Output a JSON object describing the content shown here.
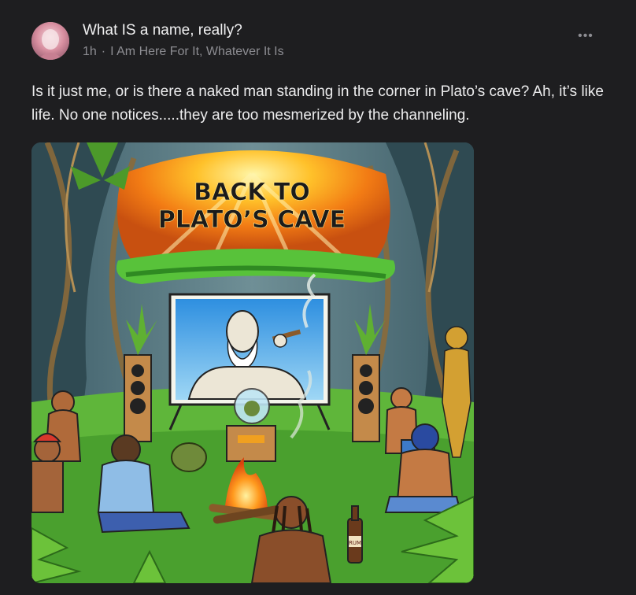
{
  "post": {
    "title": "What IS a name, really?",
    "time": "1h",
    "separator": "·",
    "category": "I Am Here For It, Whatever It Is",
    "more_icon": "more-horizontal-icon",
    "body": "Is it just me, or is there a naked man standing in the corner in Plato’s cave? Ah, it’s like life. No one notices.....they are too mesmerized by the channeling."
  },
  "image": {
    "banner_line1": "BACK TO",
    "banner_line2": "PLATO’S CAVE",
    "bottle_label": "RUM"
  }
}
